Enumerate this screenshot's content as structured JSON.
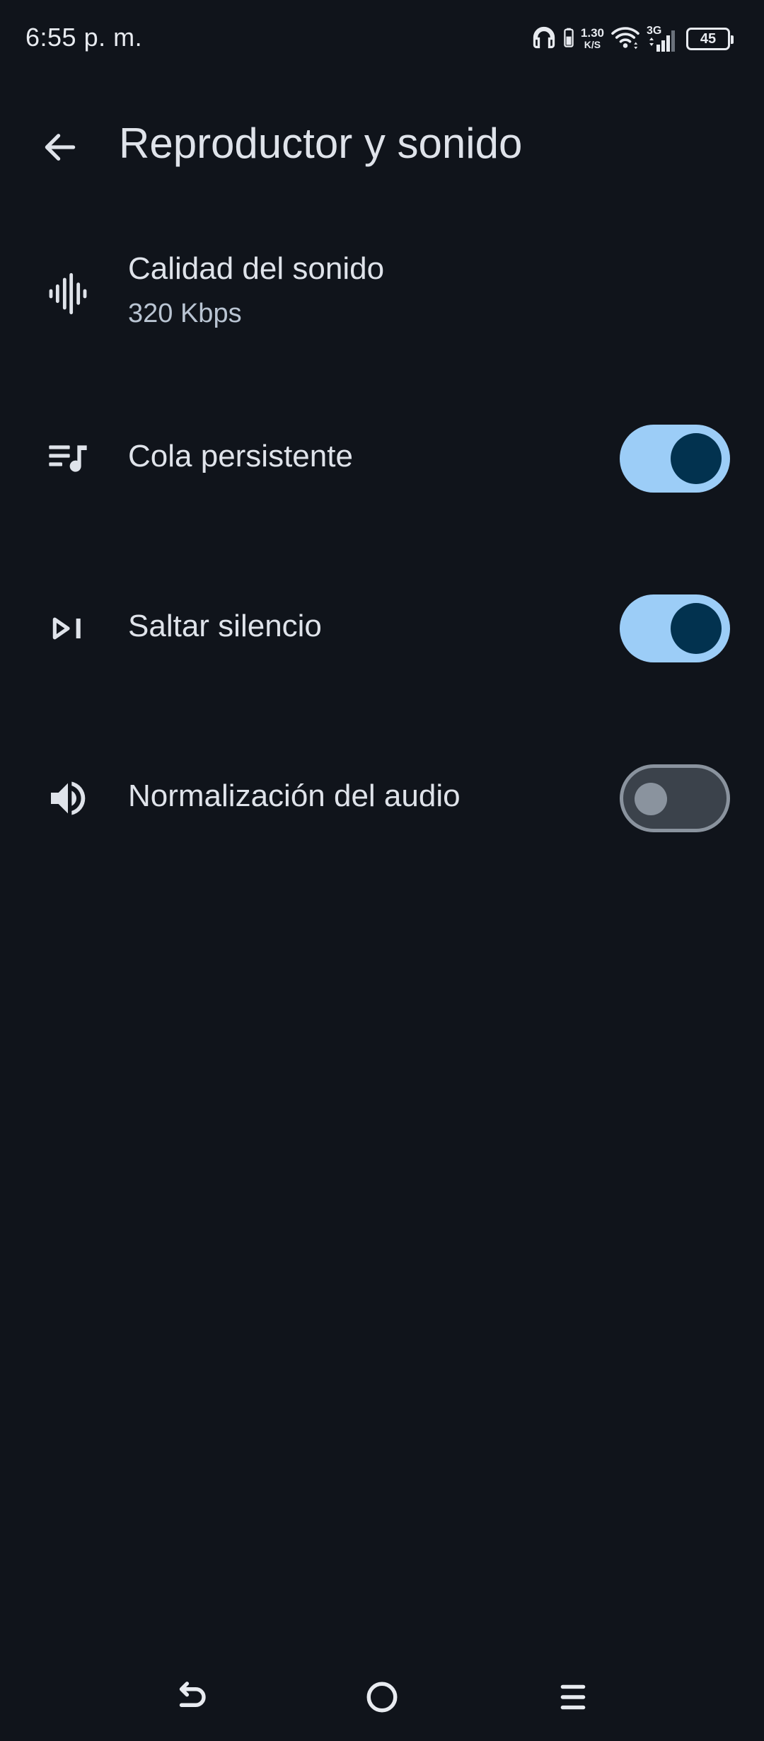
{
  "status_bar": {
    "time": "6:55 p. m.",
    "net_speed_value": "1.30",
    "net_speed_unit": "K/S",
    "network_type": "3G",
    "battery_level": "45",
    "icons": [
      "headphones-icon",
      "phone-battery-icon",
      "wifi-icon",
      "cell-signal-icon",
      "battery-icon"
    ]
  },
  "appbar": {
    "back_icon": "arrow-back-icon",
    "title": "Reproductor y sonido"
  },
  "settings": [
    {
      "icon": "waveform-icon",
      "title": "Calidad del sonido",
      "subtitle": "320 Kbps"
    },
    {
      "icon": "queue-music-icon",
      "title": "Cola persistente",
      "toggle": true
    },
    {
      "icon": "skip-next-icon",
      "title": "Saltar silencio",
      "toggle": true
    },
    {
      "icon": "volume-up-icon",
      "title": "Normalización del audio",
      "toggle": false
    }
  ],
  "nav_bar": {
    "icons": [
      "back-nav-icon",
      "home-nav-icon",
      "menu-nav-icon"
    ]
  },
  "colors": {
    "background": "#10141b",
    "toggle_on_track": "#9ccdf7",
    "toggle_on_knob": "#02324f",
    "toggle_off_track": "#3b424b",
    "toggle_off_outline": "#8a939e"
  }
}
